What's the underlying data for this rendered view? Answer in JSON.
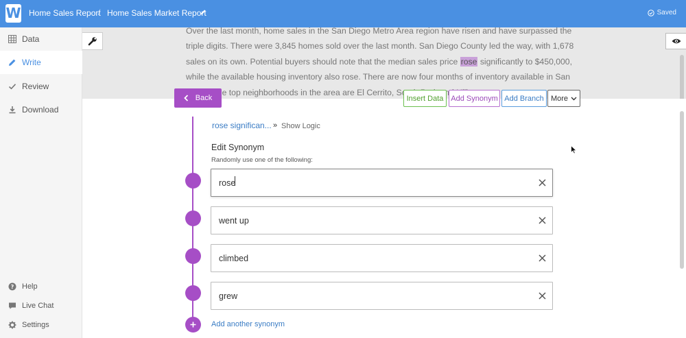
{
  "header": {
    "logo_letter": "W",
    "app_title": "Home Sales Report",
    "separator": "/",
    "doc_title": "Home Sales Market Report",
    "saved_label": "Saved"
  },
  "sidebar": {
    "items": [
      {
        "label": "Data",
        "icon": "grid-icon"
      },
      {
        "label": "Write",
        "icon": "pencil-icon",
        "active": true
      },
      {
        "label": "Review",
        "icon": "check-icon"
      },
      {
        "label": "Download",
        "icon": "download-icon"
      }
    ],
    "bottom_items": [
      {
        "label": "Help",
        "icon": "question-icon"
      },
      {
        "label": "Live Chat",
        "icon": "chat-icon"
      },
      {
        "label": "Settings",
        "icon": "gear-icon"
      }
    ]
  },
  "preview": {
    "text_before": "Over the last month, home sales in the San Diego Metro Area region have risen and have surpassed the triple digits. There were 3,845 homes sold over the last month. San Diego County led the way, with 1,678 sales on its own. Potential buyers should note that the median sales price ",
    "highlight": "rose",
    "text_after": " significantly to $450,000, while the available housing inventory also rose. There are now four months of inventory available in San Diego. The top neighborhoods in the area are El Cerrito, South Park and Hillcrest."
  },
  "toolbar": {
    "back_label": "Back",
    "insert_data": "Insert Data",
    "add_synonym": "Add Synonym",
    "add_branch": "Add Branch",
    "more": "More"
  },
  "editor": {
    "breadcrumb_link": "rose significan...",
    "breadcrumb_arrow": "»",
    "show_logic": "Show Logic",
    "title": "Edit Synonym",
    "subtitle": "Randomly use one of the following:",
    "synonyms": [
      "rose",
      "went up",
      "climbed",
      "grew"
    ],
    "add_another": "Add another synonym"
  },
  "colors": {
    "header_blue": "#4a90e2",
    "accent_purple": "#a64ec6",
    "insert_green": "#6bbf4e",
    "branch_blue": "#5a9bdc"
  }
}
